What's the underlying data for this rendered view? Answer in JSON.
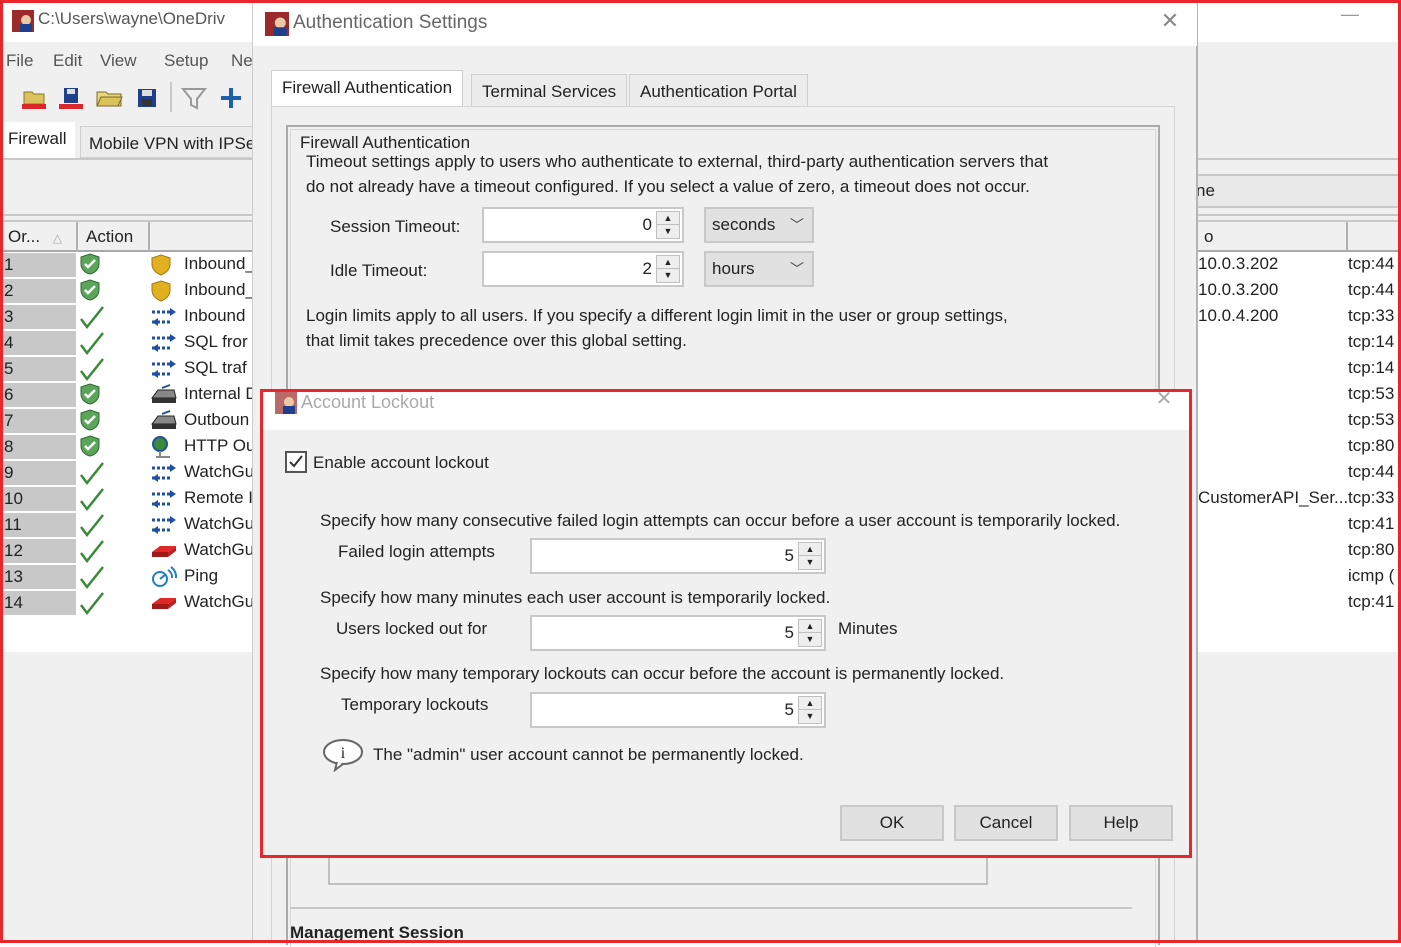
{
  "app": {
    "title": "C:\\Users\\wayne\\OneDriv",
    "menu": [
      "File",
      "Edit",
      "View",
      "Setup",
      "Ne"
    ],
    "toolbar_icons": [
      "open-from-device-icon",
      "save-to-device-icon",
      "open-file-icon",
      "save-file-icon",
      "filter-icon",
      "add-icon"
    ],
    "tabs": [
      "Firewall",
      "Mobile VPN with IPSe"
    ],
    "active_tab": "Firewall",
    "right_header_label": "ne",
    "table": {
      "columns": [
        "Or...",
        "Action",
        "",
        "o",
        ""
      ],
      "sort_indicator": "△",
      "rows": [
        {
          "order": "1",
          "action": "shield-check-icon",
          "type": "gold-shield-icon",
          "name": "Inbound_",
          "to": "10.0.3.202",
          "port": "tcp:44"
        },
        {
          "order": "2",
          "action": "shield-check-icon",
          "type": "gold-shield-icon",
          "name": "Inbound_",
          "to": "10.0.3.200",
          "port": "tcp:44"
        },
        {
          "order": "3",
          "action": "checkmark-icon",
          "type": "bidirectional-arrows-icon",
          "name": "Inbound",
          "to": "10.0.4.200",
          "port": "tcp:33"
        },
        {
          "order": "4",
          "action": "checkmark-icon",
          "type": "bidirectional-arrows-icon",
          "name": "SQL fror",
          "to": "",
          "port": "tcp:14"
        },
        {
          "order": "5",
          "action": "checkmark-icon",
          "type": "bidirectional-arrows-icon",
          "name": "SQL traf",
          "to": "",
          "port": "tcp:14"
        },
        {
          "order": "6",
          "action": "shield-check-icon",
          "type": "proxy-tray-icon",
          "name": "Internal D",
          "to": "",
          "port": "tcp:53"
        },
        {
          "order": "7",
          "action": "shield-check-icon",
          "type": "proxy-tray-icon",
          "name": "Outboun",
          "to": "",
          "port": "tcp:53"
        },
        {
          "order": "8",
          "action": "shield-check-icon",
          "type": "globe-proxy-icon",
          "name": "HTTP Ou",
          "to": "",
          "port": "tcp:80"
        },
        {
          "order": "9",
          "action": "checkmark-icon",
          "type": "bidirectional-arrows-icon",
          "name": "WatchGu",
          "to": "",
          "port": "tcp:44"
        },
        {
          "order": "10",
          "action": "checkmark-icon",
          "type": "bidirectional-arrows-icon",
          "name": "Remote I",
          "to": "CustomerAPI_Ser...",
          "port": "tcp:33"
        },
        {
          "order": "11",
          "action": "checkmark-icon",
          "type": "bidirectional-arrows-icon",
          "name": "WatchGu",
          "to": "",
          "port": "tcp:41"
        },
        {
          "order": "12",
          "action": "checkmark-icon",
          "type": "red-device-icon",
          "name": "WatchGu",
          "to": "",
          "port": "tcp:80"
        },
        {
          "order": "13",
          "action": "checkmark-icon",
          "type": "ping-icon",
          "name": "Ping",
          "to": "",
          "port": "icmp ("
        },
        {
          "order": "14",
          "action": "checkmark-icon",
          "type": "red-device-icon",
          "name": "WatchGu",
          "to": "",
          "port": "tcp:41"
        }
      ]
    }
  },
  "auth_dialog": {
    "title": "Authentication Settings",
    "close": "✕",
    "tabs": [
      "Firewall Authentication",
      "Terminal Services",
      "Authentication Portal"
    ],
    "active_tab": "Firewall Authentication",
    "group_title": "Firewall Authentication",
    "timeout_text_1": "Timeout settings apply to users who authenticate to external, third-party authentication servers that",
    "timeout_text_2": "do not already have a timeout configured. If you select a value of zero, a timeout does not occur.",
    "session_timeout": {
      "label": "Session Timeout:",
      "value": "0",
      "unit": "seconds"
    },
    "idle_timeout": {
      "label": "Idle Timeout:",
      "value": "2",
      "unit": "hours"
    },
    "login_text_1": "Login limits apply to all users. If you specify a different login limit in the user or group settings,",
    "login_text_2": "that limit takes precedence over this global setting.",
    "management_section": "Management Session"
  },
  "lockout_dialog": {
    "title": "Account Lockout",
    "close": "✕",
    "enable_label": "Enable account lockout",
    "enable_checked": true,
    "failed_desc": "Specify how many consecutive failed login attempts can occur before a user account is temporarily locked.",
    "failed_label": "Failed login attempts",
    "failed_value": "5",
    "minutes_desc": "Specify how many minutes each user account is temporarily locked.",
    "minutes_label": "Users locked out for",
    "minutes_value": "5",
    "minutes_unit": "Minutes",
    "temp_desc": "Specify how many temporary lockouts can occur before the account is permanently locked.",
    "temp_label": "Temporary lockouts",
    "temp_value": "5",
    "info_text": "The \"admin\" user account cannot be permanently locked.",
    "buttons": {
      "ok": "OK",
      "cancel": "Cancel",
      "help": "Help"
    }
  },
  "colors": {
    "annotation_red": "#e8262b",
    "window_bg": "#f0f0f0",
    "check_green": "#3a8a3a"
  }
}
